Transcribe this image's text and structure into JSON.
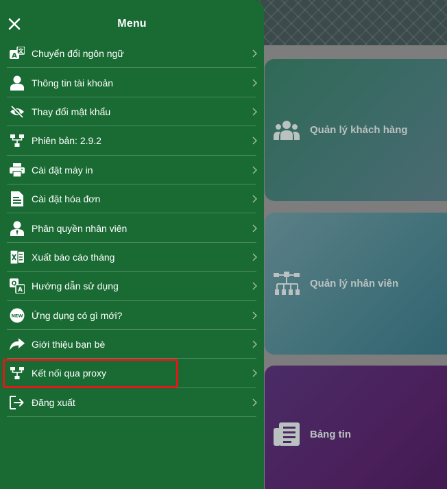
{
  "drawer": {
    "title": "Menu",
    "items": [
      {
        "label": "Chuyển đổi ngôn ngữ",
        "icon": "translate-icon"
      },
      {
        "label": "Thông tin tài khoản",
        "icon": "user-icon"
      },
      {
        "label": "Thay đổi mật khẩu",
        "icon": "eye-slash-icon"
      },
      {
        "label": "Phiên bản: 2.9.2",
        "icon": "network-icon"
      },
      {
        "label": "Cài đặt máy in",
        "icon": "printer-icon"
      },
      {
        "label": "Cài đặt hóa đơn",
        "icon": "invoice-icon"
      },
      {
        "label": "Phân quyền nhân viên",
        "icon": "user-tie-icon"
      },
      {
        "label": "Xuất báo cáo tháng",
        "icon": "excel-icon"
      },
      {
        "label": "Hướng dẫn sử dụng",
        "icon": "qa-icon"
      },
      {
        "label": "Ứng dụng có gì mới?",
        "icon": "new-badge-icon"
      },
      {
        "label": "Giới thiệu bạn bè",
        "icon": "share-icon"
      },
      {
        "label": "Kết nối qua proxy",
        "icon": "network-icon"
      },
      {
        "label": "Đăng xuất",
        "icon": "logout-icon"
      }
    ]
  },
  "background": {
    "cards": [
      {
        "label": "Quản lý khách hàng",
        "icon": "users-group-icon"
      },
      {
        "label": "Quản lý nhân viên",
        "icon": "org-chart-icon"
      },
      {
        "label": "Bảng tin",
        "icon": "newspaper-icon"
      }
    ]
  },
  "colors": {
    "drawer": "#196b33",
    "highlight": "#e01a1a"
  }
}
